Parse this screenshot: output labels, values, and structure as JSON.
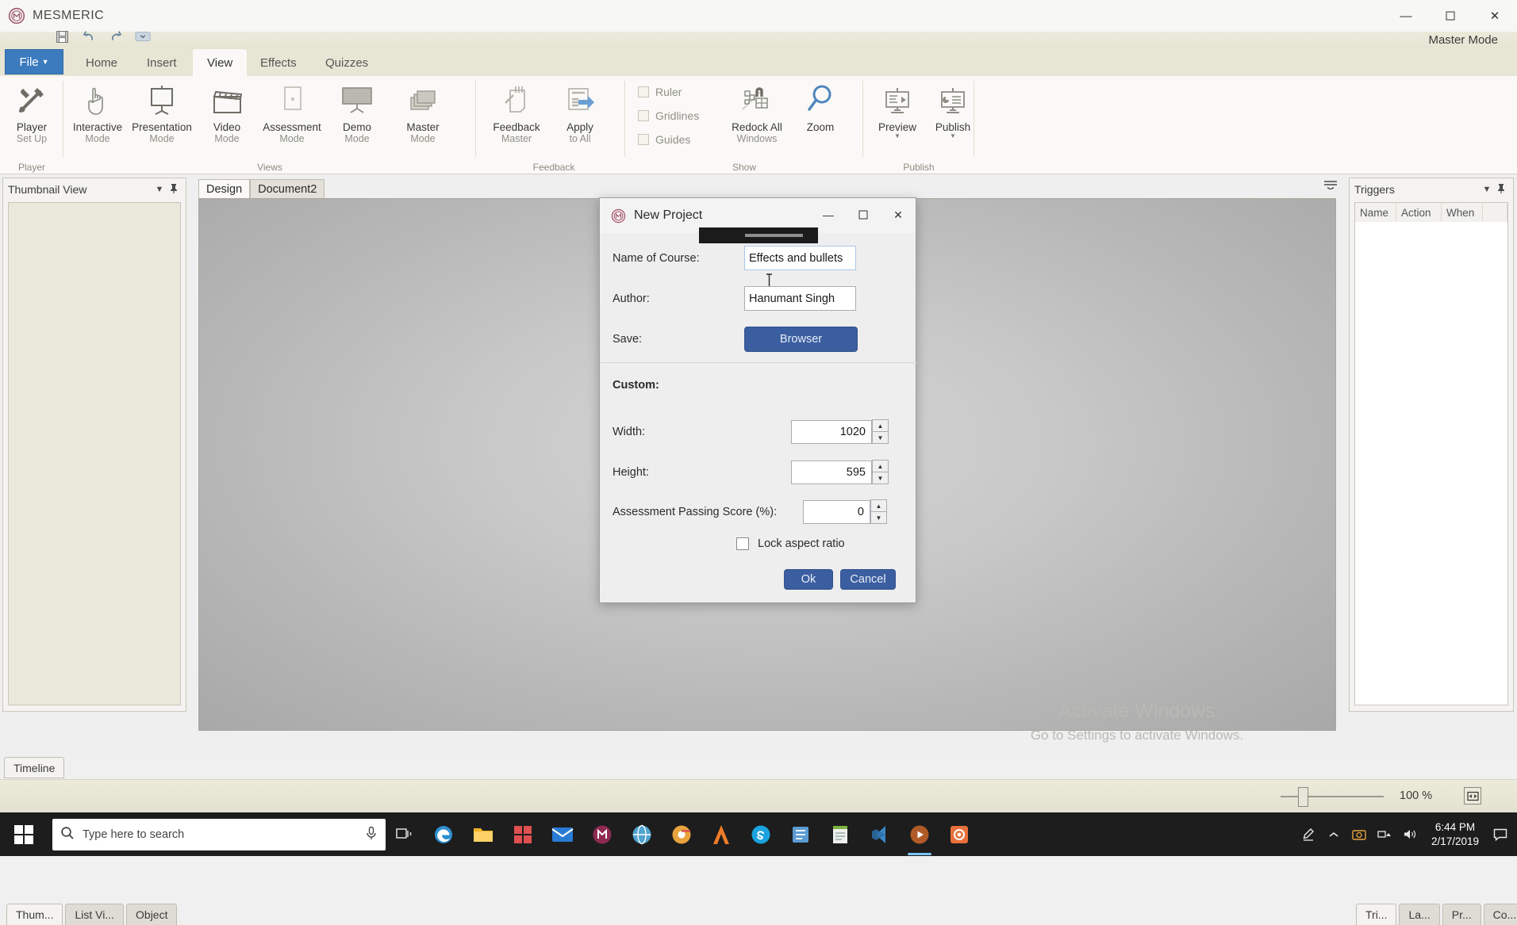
{
  "app": {
    "title": "MESMERIC",
    "logo_icon": "mesmeric-logo-icon",
    "mode_label": "Master Mode",
    "window_minimize": "—",
    "window_maximize": "☐",
    "window_close": "✕"
  },
  "quick_access": {
    "save_icon": "save-icon",
    "undo_icon": "undo-icon",
    "redo_icon": "redo-icon",
    "customize_icon": "chevron-down-icon"
  },
  "ribbon": {
    "file_tab": "File",
    "tabs": [
      {
        "label": "Home",
        "active": false
      },
      {
        "label": "Insert",
        "active": false
      },
      {
        "label": "View",
        "active": true
      },
      {
        "label": "Effects",
        "active": false
      },
      {
        "label": "Quizzes",
        "active": false
      }
    ],
    "groups": [
      {
        "name": "Player",
        "items": [
          {
            "line1": "Player",
            "line2": "Set Up",
            "icon": "tools-icon"
          }
        ]
      },
      {
        "name": "Views",
        "items": [
          {
            "line1": "Interactive",
            "line2": "Mode",
            "icon": "hand-pointer-icon"
          },
          {
            "line1": "Presentation",
            "line2": "Mode",
            "icon": "presentation-screen-icon"
          },
          {
            "line1": "Video",
            "line2": "Mode",
            "icon": "clapperboard-icon"
          },
          {
            "line1": "Assessment",
            "line2": "Mode",
            "icon": "document-page-icon"
          },
          {
            "line1": "Demo",
            "line2": "Mode",
            "icon": "projector-screen-icon"
          },
          {
            "line1": "Master",
            "line2": "Mode",
            "icon": "layers-icon"
          }
        ]
      },
      {
        "name": "Feedback",
        "items": [
          {
            "line1": "Feedback",
            "line2": "Master",
            "icon": "pen-notes-icon"
          },
          {
            "line1": "Apply",
            "line2": "to All",
            "icon": "apply-arrow-icon"
          }
        ]
      },
      {
        "name": "Show",
        "checkboxes": [
          {
            "label": "Ruler",
            "checked": false
          },
          {
            "label": "Gridlines",
            "checked": false
          },
          {
            "label": "Guides",
            "checked": false
          }
        ],
        "items": [
          {
            "line1": "Redock All",
            "line2": "Windows",
            "icon": "redock-windows-icon"
          },
          {
            "line1": "Zoom",
            "line2": "",
            "icon": "magnifier-icon"
          }
        ]
      },
      {
        "name": "Publish",
        "items": [
          {
            "line1": "Preview",
            "line2": "",
            "icon": "preview-monitor-icon",
            "caret": true
          },
          {
            "line1": "Publish",
            "line2": "",
            "icon": "publish-monitor-icon",
            "caret": true
          }
        ]
      }
    ]
  },
  "left_panel": {
    "title": "Thumbnail View",
    "dropdown_icon": "chevron-down-icon",
    "pin_icon": "pin-icon",
    "tabs": [
      {
        "label": "Thum...",
        "active": true
      },
      {
        "label": "List Vi...",
        "active": false
      },
      {
        "label": "Object",
        "active": false
      }
    ],
    "timeline_tab": "Timeline"
  },
  "canvas": {
    "tabs": [
      {
        "label": "Design",
        "active": true
      },
      {
        "label": "Document2",
        "active": false
      }
    ],
    "overflow_icon": "overflow-menu-icon",
    "watermark_line1": "Activate Windows",
    "watermark_line2": "Go to Settings to activate Windows."
  },
  "right_panel": {
    "title": "Triggers",
    "dropdown_icon": "chevron-down-icon",
    "pin_icon": "pin-icon",
    "columns": [
      "Name",
      "Action",
      "When"
    ],
    "tabs": [
      {
        "label": "Tri...",
        "active": true
      },
      {
        "label": "La...",
        "active": false
      },
      {
        "label": "Pr...",
        "active": false
      },
      {
        "label": "Co...",
        "active": false
      }
    ]
  },
  "status_bar": {
    "zoom_percent": "100 %",
    "fit_icon": "fit-to-screen-icon"
  },
  "dialog": {
    "title": "New Project",
    "logo_icon": "mesmeric-logo-icon",
    "minimize": "—",
    "maximize": "☐",
    "close": "✕",
    "fields": {
      "course_label": "Name of Course:",
      "course_value": "Effects and bullets",
      "author_label": "Author:",
      "author_value": "Hanumant Singh",
      "save_label": "Save:",
      "browser_button": "Browser"
    },
    "custom_label": "Custom:",
    "custom": [
      {
        "label": "Width:",
        "value": "1020"
      },
      {
        "label": "Height:",
        "value": "595"
      },
      {
        "label": "Assessment Passing Score (%):",
        "value": "0"
      }
    ],
    "lock_aspect_label": "Lock aspect ratio",
    "lock_aspect_checked": false,
    "ok_button": "Ok",
    "cancel_button": "Cancel"
  },
  "taskbar": {
    "start_icon": "windows-start-icon",
    "search_placeholder": "Type here to search",
    "search_icon": "search-icon",
    "mic_icon": "microphone-icon",
    "taskview_icon": "task-view-icon",
    "apps": [
      {
        "name": "edge-icon",
        "color": "#3aa0d8",
        "active": false
      },
      {
        "name": "file-explorer-icon",
        "color": "#f5c242",
        "active": false
      },
      {
        "name": "store-icon",
        "color": "#d94f4f",
        "active": false
      },
      {
        "name": "mail-icon",
        "color": "#2a7bd4",
        "active": false
      },
      {
        "name": "mesmeric-icon",
        "color": "#9b2a5c",
        "active": false
      },
      {
        "name": "browser-icon",
        "color": "#4fa3d0",
        "active": false
      },
      {
        "name": "chrome-icon",
        "color": "#e8a33d",
        "active": false
      },
      {
        "name": "creative-icon",
        "color": "#f07d28",
        "active": false
      },
      {
        "name": "skype-icon",
        "color": "#1aa3e0",
        "active": false
      },
      {
        "name": "office-icon",
        "color": "#5a9bd4",
        "active": false
      },
      {
        "name": "notes-icon",
        "color": "#7cb342",
        "active": false
      },
      {
        "name": "vscode-icon",
        "color": "#3a86c8",
        "active": false
      },
      {
        "name": "media-icon",
        "color": "#b05a28",
        "active": true
      },
      {
        "name": "recorder-icon",
        "color": "#e8703a",
        "active": true
      }
    ],
    "tray": [
      {
        "name": "pen-icon"
      },
      {
        "name": "chevron-up-icon"
      },
      {
        "name": "camera-icon"
      },
      {
        "name": "network-icon"
      },
      {
        "name": "volume-icon"
      }
    ],
    "clock_time": "6:44 PM",
    "clock_date": "2/17/2019",
    "notification_icon": "notification-icon"
  }
}
